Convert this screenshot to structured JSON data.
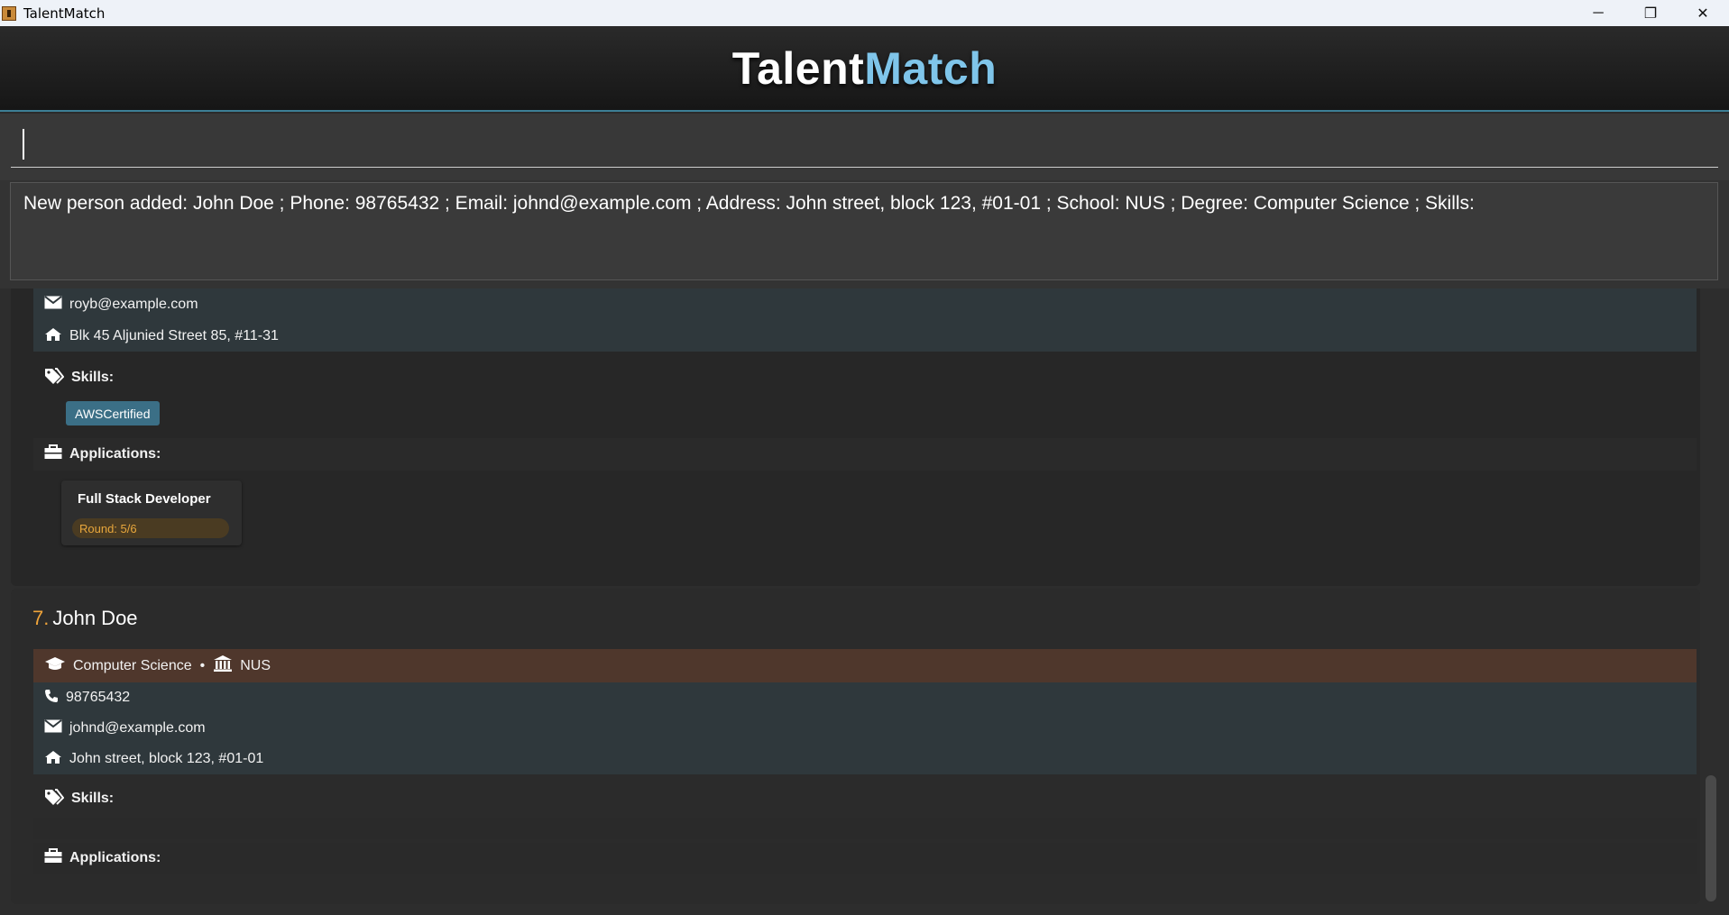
{
  "window": {
    "title": "TalentMatch",
    "controls": {
      "minimize": "─",
      "maximize": "❐",
      "close": "✕"
    }
  },
  "header": {
    "brand_part1": "Talent",
    "brand_part2": "Match"
  },
  "command": {
    "value": "",
    "placeholder": ""
  },
  "result": {
    "text": "New person added: John Doe ; Phone: 98765432 ; Email: johnd@example.com ; Address: John street, block 123, #01-01 ; School: NUS ; Degree: Computer Science ; Skills:"
  },
  "persons": [
    {
      "email": "royb@example.com",
      "address": "Blk 45 Aljunied Street 85, #11-31",
      "skills_label": "Skills:",
      "skills": [
        "AWSCertified"
      ],
      "applications_label": "Applications:",
      "applications": [
        {
          "title": "Full Stack Developer",
          "round": "Round: 5/6"
        }
      ]
    },
    {
      "index": "7.",
      "name": "John Doe",
      "degree": "Computer Science",
      "separator": "•",
      "school": "NUS",
      "phone": "98765432",
      "email": "johnd@example.com",
      "address": "John street, block 123, #01-01",
      "skills_label": "Skills:",
      "skills": [],
      "applications_label": "Applications:",
      "applications": []
    }
  ],
  "icons": {
    "email": "envelope-icon",
    "address": "home-icon",
    "skills": "tags-icon",
    "applications": "briefcase-icon",
    "degree": "graduation-cap-icon",
    "school": "university-icon",
    "phone": "phone-icon"
  },
  "colors": {
    "brand_accent": "#7fc5ea",
    "header_border": "#3d7f96",
    "tag_bg": "#3b6f86",
    "round_text": "#e8a73c",
    "index_color": "#f0a43a",
    "edu_row_bg": "#4f372c",
    "contact_row_bg": "#2f383c"
  }
}
